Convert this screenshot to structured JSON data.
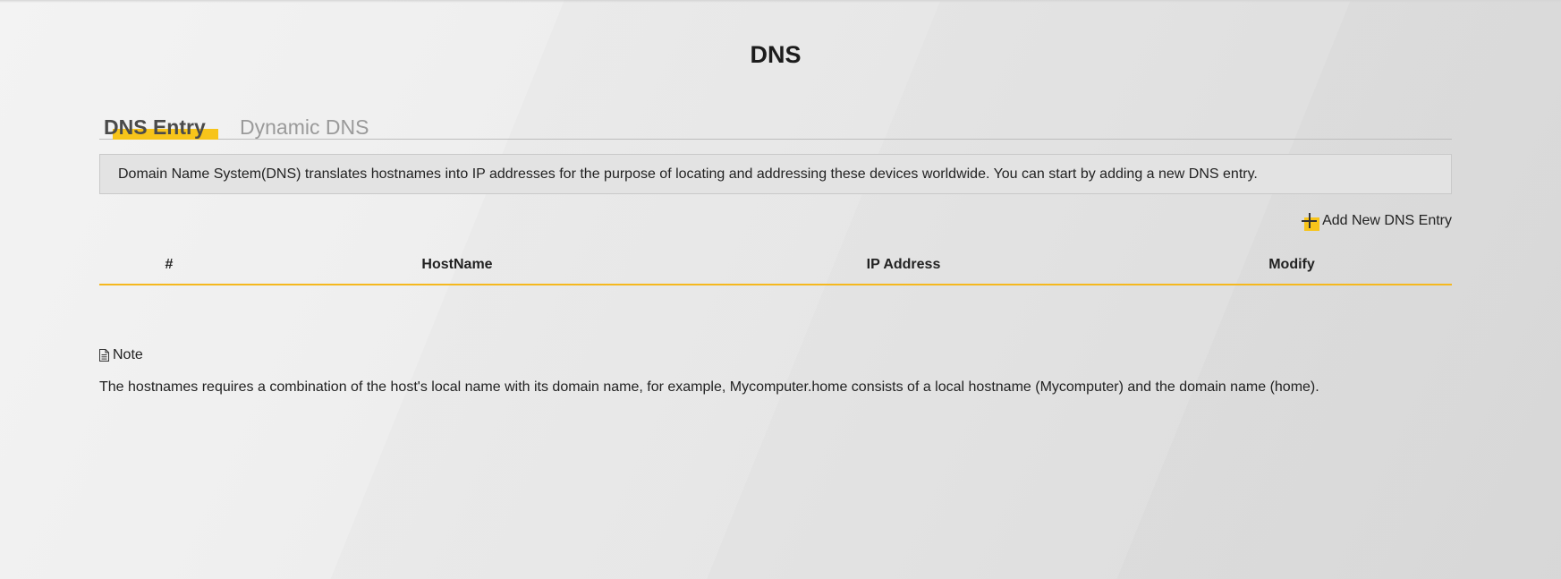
{
  "page": {
    "title": "DNS"
  },
  "tabs": [
    {
      "label": "DNS Entry",
      "active": true
    },
    {
      "label": "Dynamic DNS",
      "active": false
    }
  ],
  "info": {
    "text": "Domain Name System(DNS) translates hostnames into IP addresses for the purpose of locating and addressing these devices worldwide. You can start by adding a new DNS entry."
  },
  "actions": {
    "add_label": "Add New DNS Entry",
    "add_icon": "plus-icon"
  },
  "table": {
    "columns": [
      "#",
      "HostName",
      "IP Address",
      "Modify"
    ],
    "rows": []
  },
  "note": {
    "icon": "document-icon",
    "title": "Note",
    "text": "The hostnames requires a combination of the host's local name with its domain name, for example, Mycomputer.home consists of a local hostname (Mycomputer) and the domain name (home)."
  },
  "colors": {
    "accent": "#f7c41a",
    "table_border": "#f5b81e",
    "background": "#ececec"
  }
}
